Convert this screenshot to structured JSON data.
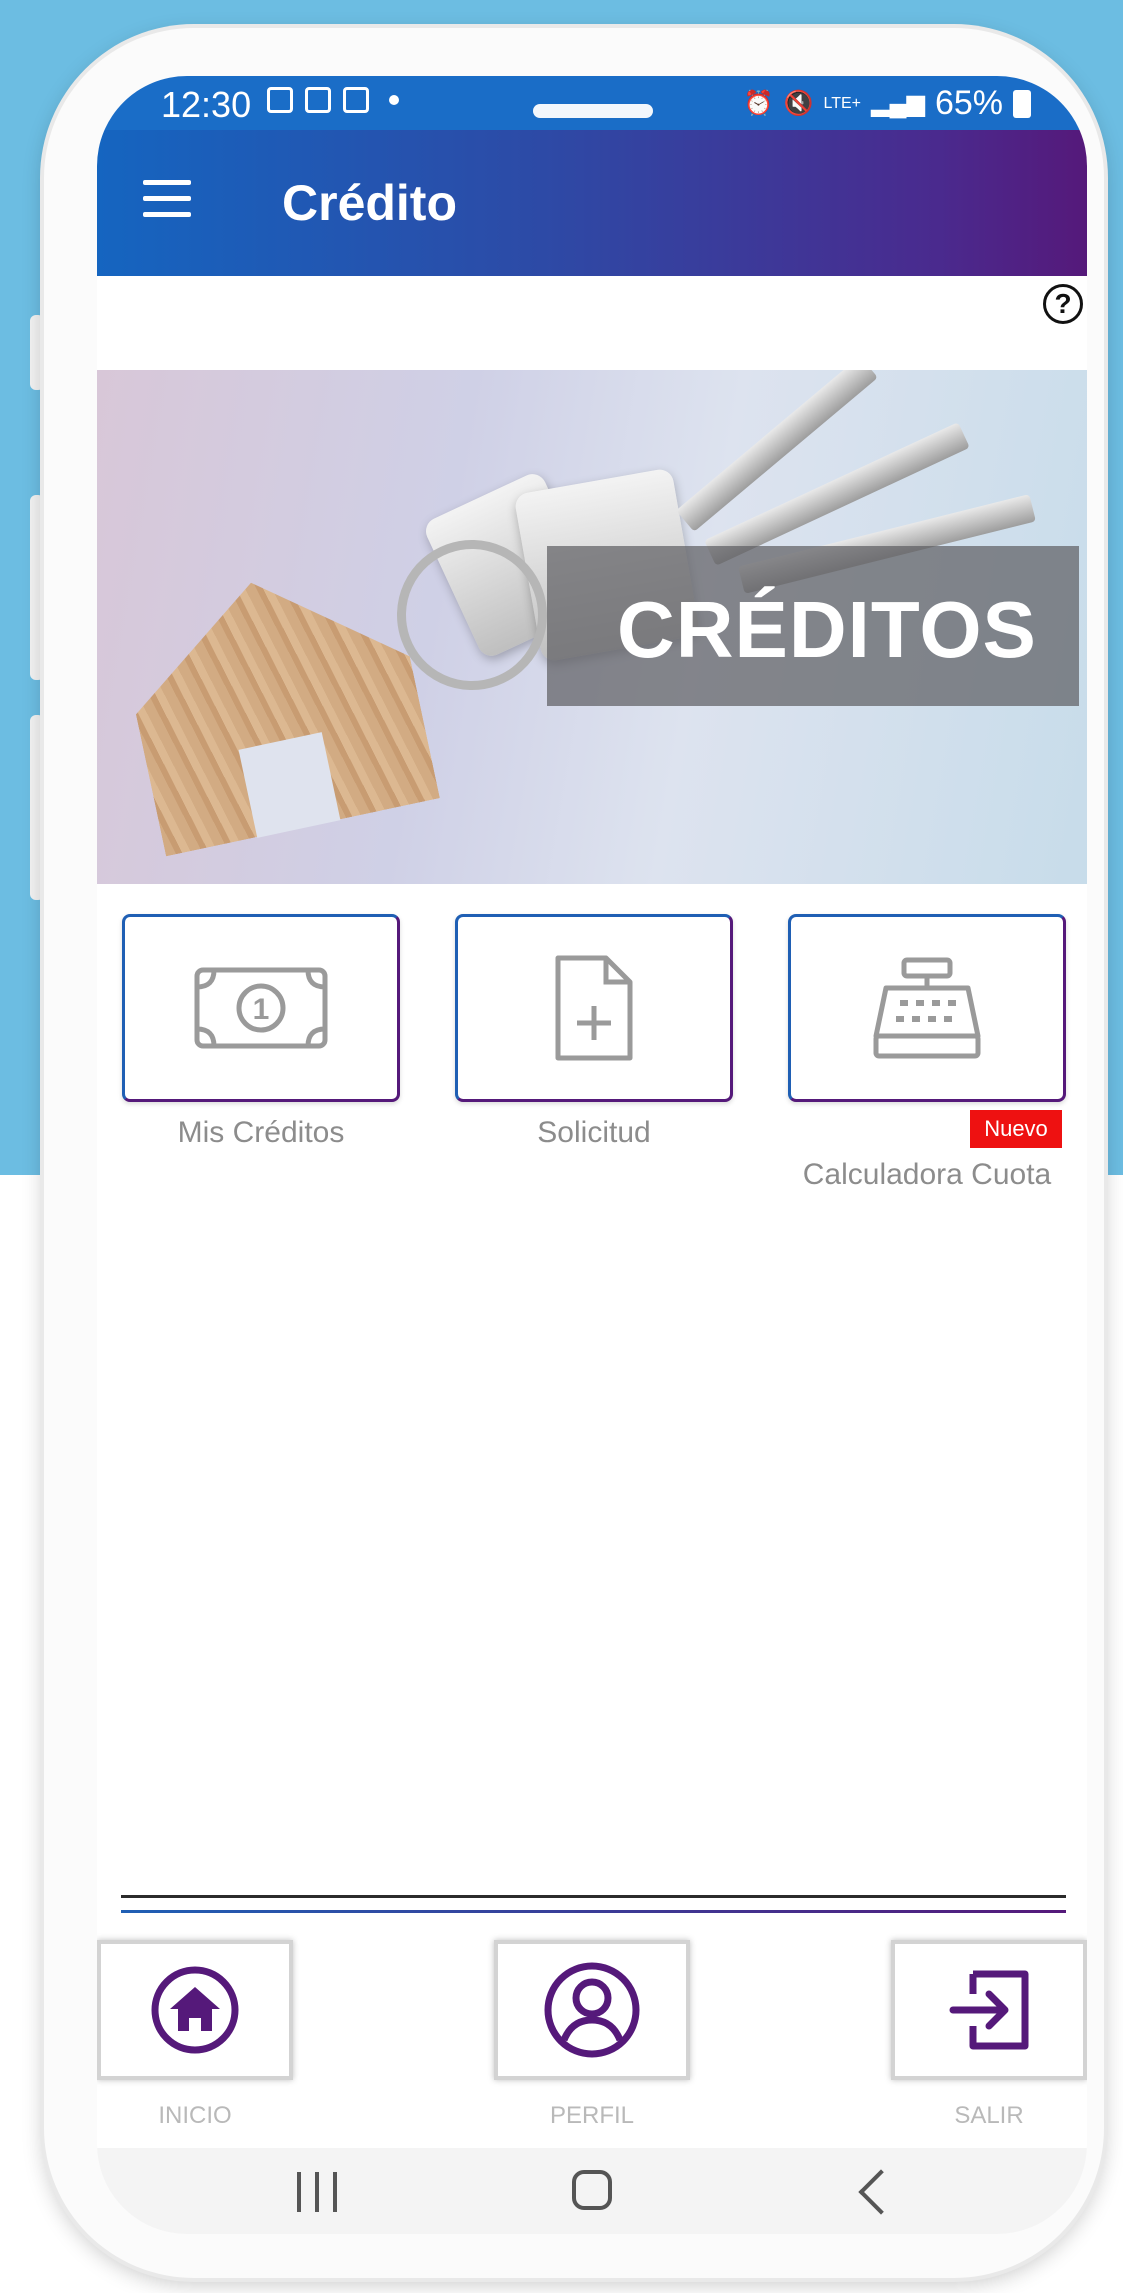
{
  "statusbar": {
    "time": "12:30",
    "network": "LTE+",
    "battery": "65%"
  },
  "appbar": {
    "title": "Crédito"
  },
  "banner": {
    "label": "CRÉDITOS"
  },
  "tiles": [
    {
      "label": "Mis Créditos",
      "icon": "money-bill-icon"
    },
    {
      "label": "Solicitud",
      "icon": "file-add-icon"
    },
    {
      "label": "Calculadora Cuota",
      "icon": "cash-register-icon",
      "badge": "Nuevo"
    }
  ],
  "bottom_nav": [
    {
      "label": "INICIO",
      "icon": "home-icon"
    },
    {
      "label": "PERFIL",
      "icon": "profile-icon"
    },
    {
      "label": "SALIR",
      "icon": "logout-icon"
    }
  ],
  "colors": {
    "background": "#6cbde2",
    "appbar_start": "#1565c0",
    "appbar_end": "#55197a",
    "icon_purple": "#55197a",
    "badge_red": "#ee1111",
    "tile_icon_gray": "#9a9a9a"
  }
}
